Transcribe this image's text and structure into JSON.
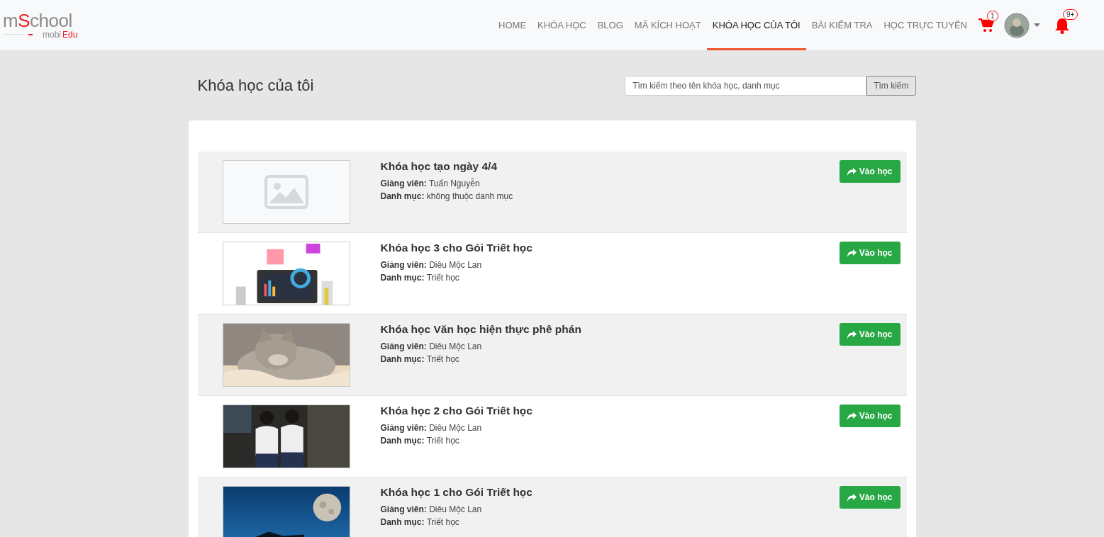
{
  "logo": {
    "lead": "m",
    "accent": "S",
    "rest": "chool",
    "sub": "mobi",
    "sub_accent": "Edu"
  },
  "nav": [
    {
      "label": "HOME",
      "selected": false
    },
    {
      "label": "KHÓA HỌC",
      "selected": false
    },
    {
      "label": "BLOG",
      "selected": false
    },
    {
      "label": "MÃ KÍCH HOẠT",
      "selected": false
    },
    {
      "label": "KHÓA HỌC CỦA TÔI",
      "selected": true
    },
    {
      "label": "BÀI KIỂM TRA",
      "selected": false
    },
    {
      "label": "HỌC TRỰC TUYẾN",
      "selected": false
    }
  ],
  "cart": {
    "count": "1"
  },
  "notifications": {
    "count": "9+"
  },
  "page_title": "Khóa học của tôi",
  "search": {
    "placeholder": "Tìm kiếm theo tên khóa học, danh mục",
    "button": "Tìm kiếm"
  },
  "courses": [
    {
      "thumb": {
        "kind": "placeholder"
      },
      "title": "Khóa học tạo ngày 4/4",
      "teacher_label": "Giảng viên:",
      "teacher": "Tuấn Nguyễn",
      "category_label": "Danh mục:",
      "category": "không thuộc danh mục",
      "button": "Vào học"
    },
    {
      "title": "Khóa học 3 cho Gói Triết học",
      "teacher_label": "Giảng viên:",
      "teacher": "Diêu Mộc Lan",
      "category_label": "Danh mục:",
      "category": "Triết học",
      "button": "Vào học"
    },
    {
      "title": "Khóa học Văn học hiện thực phê phán",
      "teacher_label": "Giảng viên:",
      "teacher": "Diêu Mộc Lan",
      "category_label": "Danh mục:",
      "category": "Triết học",
      "button": "Vào học"
    },
    {
      "title": "Khóa học 2 cho Gói Triết học",
      "teacher_label": "Giảng viên:",
      "teacher": "Diêu Mộc Lan",
      "category_label": "Danh mục:",
      "category": "Triết học",
      "button": "Vào học"
    },
    {
      "title": "Khóa học 1 cho Gói Triết học",
      "teacher_label": "Giảng viên:",
      "teacher": "Diêu Mộc Lan",
      "category_label": "Danh mục:",
      "category": "Triết học",
      "button": "Vào học"
    }
  ]
}
